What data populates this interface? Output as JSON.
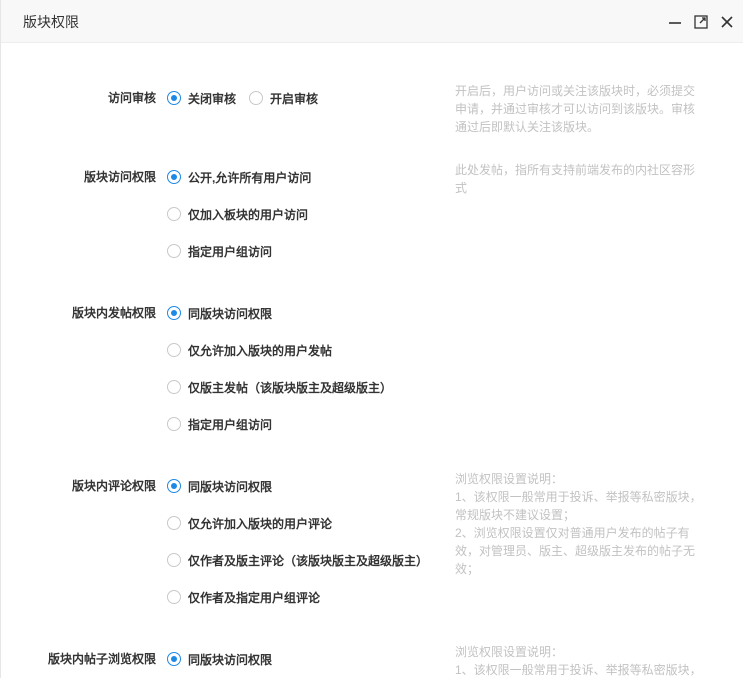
{
  "window": {
    "title": "版块权限"
  },
  "sections": {
    "review": {
      "label": "访问审核",
      "options": [
        "关闭审核",
        "开启审核"
      ],
      "help": "开启后，用户访问或关注该版块时，必须提交\n申请，并通过审核才可以访问到该版块。审核\n通过后即默认关注该版块。"
    },
    "access": {
      "label": "版块访问权限",
      "options": [
        "公开,允许所有用户访问",
        "仅加入板块的用户访问",
        "指定用户组访问"
      ],
      "help": "此处发帖，指所有支持前端发布的内社区容形\n式"
    },
    "post": {
      "label": "版块内发帖权限",
      "options": [
        "同版块访问权限",
        "仅允许加入版块的用户发帖",
        "仅版主发帖（该版块版主及超级版主）",
        "指定用户组访问"
      ]
    },
    "comment": {
      "label": "版块内评论权限",
      "options": [
        "同版块访问权限",
        "仅允许加入版块的用户评论",
        "仅作者及版主评论（该版块版主及超级版主）",
        "仅作者及指定用户组评论"
      ],
      "help": "浏览权限设置说明：\n1、该权限一般常用于投诉、举报等私密版块，\n常规版块不建议设置；\n2、浏览权限设置仅对普通用户发布的帖子有\n效，对管理员、版主、超级版主发布的帖子无\n效；"
    },
    "browse": {
      "label": "版块内帖子浏览权限",
      "options": [
        "同版块访问权限"
      ],
      "help": "浏览权限设置说明：\n1、该权限一般常用于投诉、举报等私密版块，"
    }
  },
  "colors": {
    "accent": "#1e88e5",
    "help_text": "#c2c2c2",
    "titlebar_bg": "#f8f8f8"
  }
}
